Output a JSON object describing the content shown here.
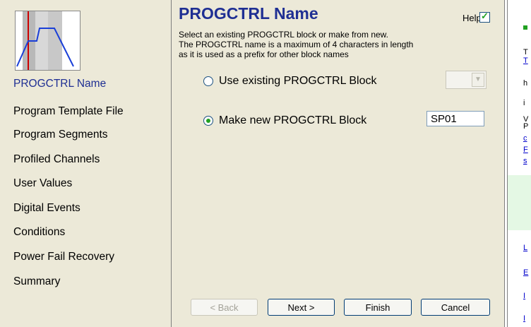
{
  "left_nav": {
    "items": [
      {
        "label": "PROGCTRL Name",
        "active": true
      },
      {
        "label": "Program Template File",
        "active": false
      },
      {
        "label": "Program Segments",
        "active": false
      },
      {
        "label": "Profiled Channels",
        "active": false
      },
      {
        "label": "User Values",
        "active": false
      },
      {
        "label": "Digital Events",
        "active": false
      },
      {
        "label": "Conditions",
        "active": false
      },
      {
        "label": "Power Fail Recovery",
        "active": false
      },
      {
        "label": "Summary",
        "active": false
      }
    ]
  },
  "main": {
    "title": "PROGCTRL Name",
    "help_label": "Help",
    "help_checked": true,
    "desc_line1": "Select an existing PROGCTRL block or make from new.",
    "desc_line2": "The PROGCTRL name is a maximum of 4  characters in length",
    "desc_line3": "as it is used as a prefix for other block names",
    "option_existing": "Use existing PROGCTRL Block",
    "option_new": "Make new PROGCTRL Block",
    "new_block_name": "SP01",
    "selected_option": "new"
  },
  "buttons": {
    "back": "< Back",
    "next": "Next >",
    "finish": "Finish",
    "cancel": "Cancel"
  },
  "right_panel": {
    "visible_chars": [
      "T",
      "T",
      "h",
      "i",
      "V",
      "P",
      "c",
      "F",
      "s",
      "L",
      "E",
      "I",
      "I"
    ]
  },
  "colors": {
    "accent": "#1f2f93",
    "background": "#ece9d8",
    "check_green": "#21a121"
  }
}
